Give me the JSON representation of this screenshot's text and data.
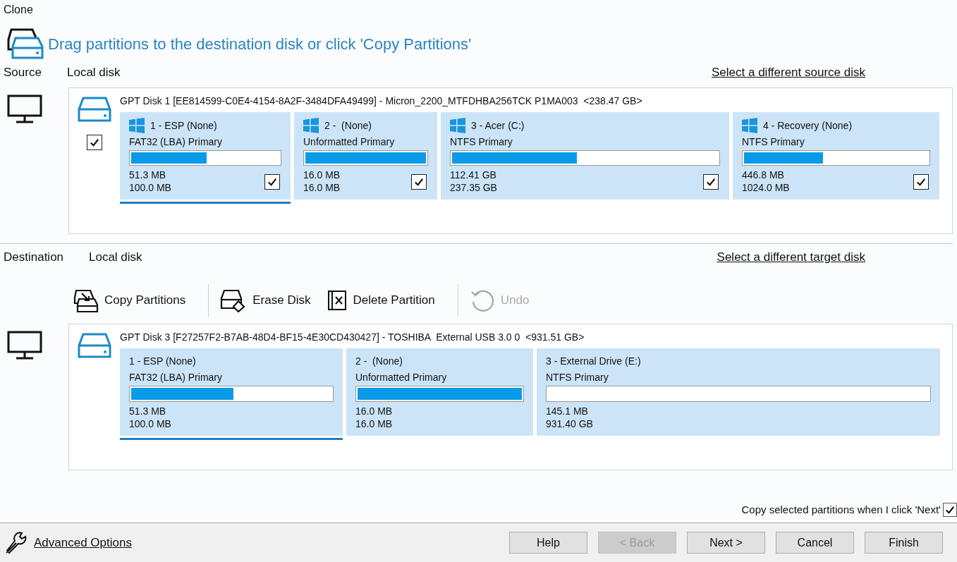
{
  "window": {
    "title": "Clone"
  },
  "instruction": "Drag partitions to the destination disk or click 'Copy Partitions'",
  "source": {
    "label": "Source",
    "disk_type": "Local disk",
    "change_link": "Select a different source disk",
    "checked": true,
    "disk": {
      "title": "GPT Disk 1 [EE814599-C0E4-4154-8A2F-3484DFA49499] - Micron_2200_MTFDHBA256TCK P1MA003  <238.47 GB>",
      "partitions": [
        {
          "name": "1 - ESP (None)",
          "type": "FAT32 (LBA) Primary",
          "level": 0.51,
          "used": "51.3 MB",
          "size": "100.0 MB",
          "checked": true,
          "selected": true
        },
        {
          "name": "2 -  (None)",
          "type": "Unformatted Primary",
          "level": 1,
          "used": "16.0 MB",
          "size": "16.0 MB",
          "checked": true,
          "selected": false
        },
        {
          "name": "3 - Acer (C:)",
          "type": "NTFS Primary",
          "level": 0.47,
          "used": "112.41 GB",
          "size": "237.35 GB",
          "checked": true,
          "selected": false
        },
        {
          "name": "4 - Recovery (None)",
          "type": "NTFS Primary",
          "level": 0.43,
          "used": "446.8 MB",
          "size": "1024.0 MB",
          "checked": true,
          "selected": false
        }
      ]
    }
  },
  "destination": {
    "label": "Destination",
    "disk_type": "Local disk",
    "change_link": "Select a different target disk",
    "toolbar": [
      {
        "kind": "copy",
        "label": "Copy Partitions",
        "disabled": false
      },
      {
        "kind": "erase",
        "label": "Erase Disk",
        "disabled": false
      },
      {
        "kind": "delete",
        "label": "Delete Partition",
        "disabled": false
      },
      {
        "kind": "undo",
        "label": "Undo",
        "disabled": true
      }
    ],
    "disk": {
      "title": "GPT Disk 3 [F27257F2-B7AB-48D4-BF15-4E30CD430427] - TOSHIBA  External USB 3.0 0  <931.51 GB>",
      "partitions": [
        {
          "name": "1 - ESP (None)",
          "type": "FAT32 (LBA) Primary",
          "level": 0.51,
          "used": "51.3 MB",
          "size": "100.0 MB",
          "selected": true
        },
        {
          "name": "2 -  (None)",
          "type": "Unformatted Primary",
          "level": 1,
          "used": "16.0 MB",
          "size": "16.0 MB",
          "selected": false
        },
        {
          "name": "3 - External Drive (E:)",
          "type": "NTFS Primary",
          "level": 0,
          "used": "145.1 MB",
          "size": "931.40 GB",
          "selected": false
        }
      ]
    }
  },
  "copy_option": {
    "label": "Copy selected partitions when I click 'Next'",
    "checked": true
  },
  "advanced_options": "Advanced Options",
  "buttons": [
    {
      "label": "Help",
      "disabled": false
    },
    {
      "label": "< Back",
      "disabled": true
    },
    {
      "label": "Next >",
      "disabled": false
    },
    {
      "label": "Cancel",
      "disabled": false
    },
    {
      "label": "Finish",
      "disabled": false
    }
  ]
}
